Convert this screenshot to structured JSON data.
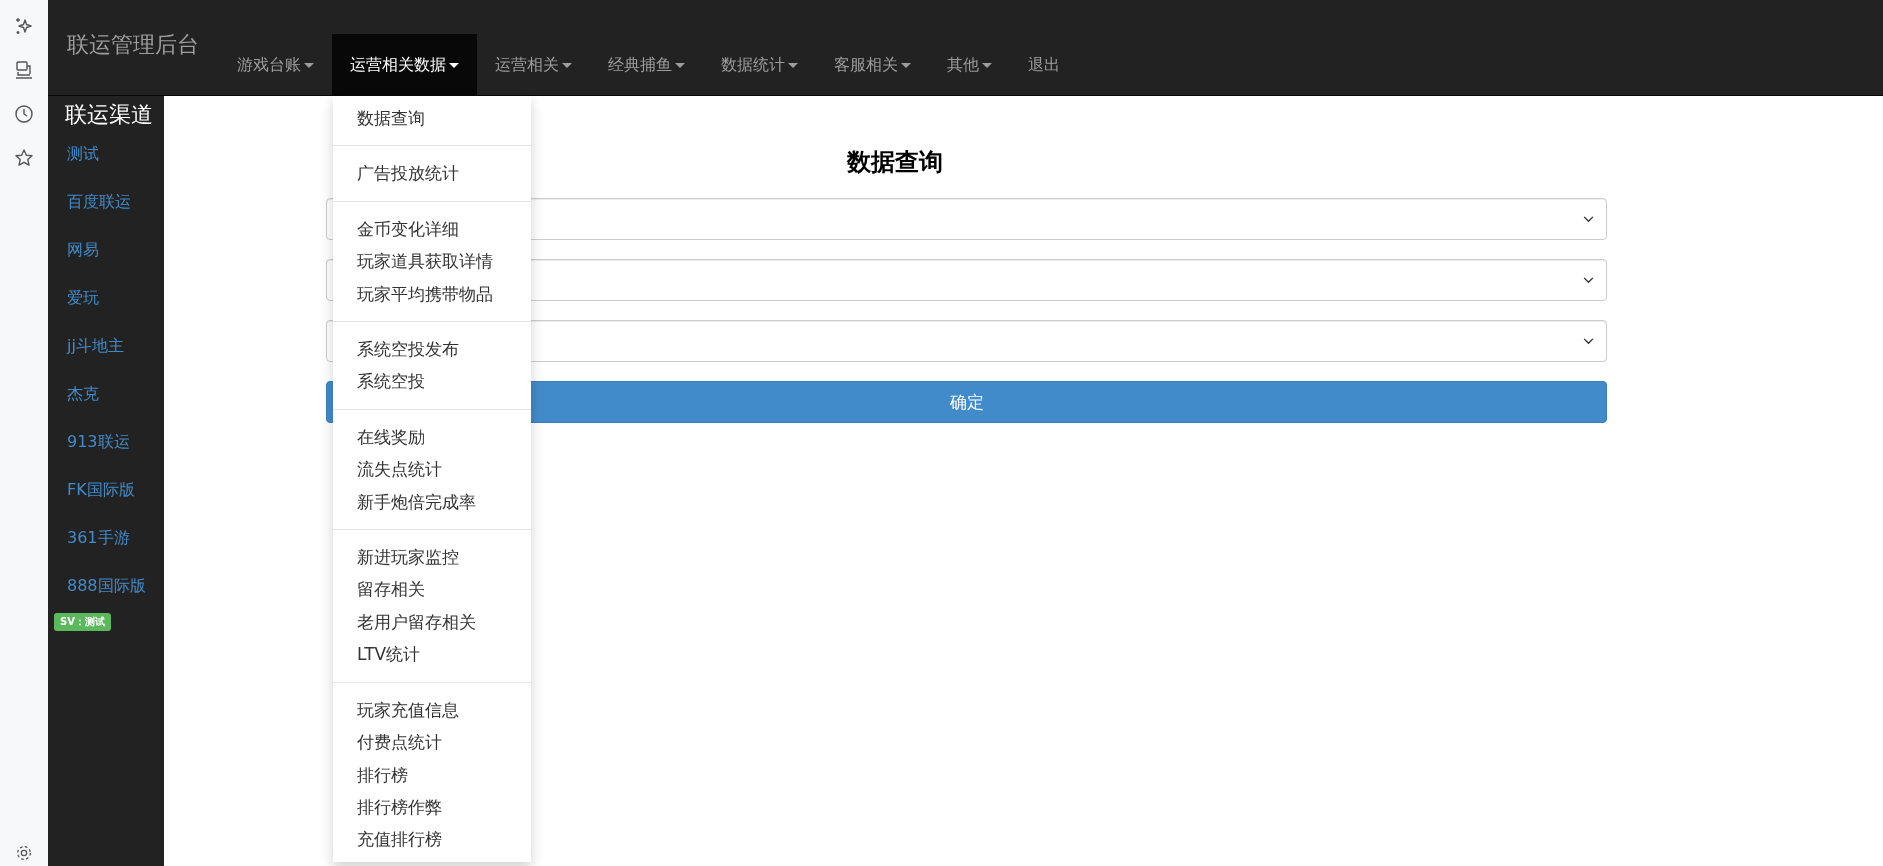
{
  "brand": "联运管理后台",
  "nav": [
    {
      "label": "游戏台账",
      "caret": true,
      "selected": false
    },
    {
      "label": "运营相关数据",
      "caret": true,
      "selected": true
    },
    {
      "label": "运营相关",
      "caret": true,
      "selected": false
    },
    {
      "label": "经典捕鱼",
      "caret": true,
      "selected": false
    },
    {
      "label": "数据统计",
      "caret": true,
      "selected": false
    },
    {
      "label": "客服相关",
      "caret": true,
      "selected": false
    },
    {
      "label": "其他",
      "caret": true,
      "selected": false
    },
    {
      "label": "退出",
      "caret": false,
      "selected": false
    }
  ],
  "dropdown": [
    [
      "数据查询"
    ],
    [
      "广告投放统计"
    ],
    [
      "金币变化详细",
      "玩家道具获取详情",
      "玩家平均携带物品"
    ],
    [
      "系统空投发布",
      "系统空投"
    ],
    [
      "在线奖励",
      "流失点统计",
      "新手炮倍完成率"
    ],
    [
      "新进玩家监控",
      "留存相关",
      "老用户留存相关",
      "LTV统计"
    ],
    [
      "玩家充值信息",
      "付费点统计",
      "排行榜",
      "排行榜作弊",
      "充值排行榜"
    ]
  ],
  "sidebar": {
    "title": "联运渠道",
    "items": [
      "测试",
      "百度联运",
      "网易",
      "爱玩",
      "jj斗地主",
      "杰克",
      "913联运",
      "FK国际版",
      "361手游",
      "888国际版"
    ],
    "badge": "SV：测试"
  },
  "form": {
    "title": "数据查询",
    "selects": [
      {
        "kind": "dropdown"
      },
      {
        "kind": "dropdown"
      },
      {
        "kind": "dropdown"
      }
    ],
    "submit": "确定"
  }
}
